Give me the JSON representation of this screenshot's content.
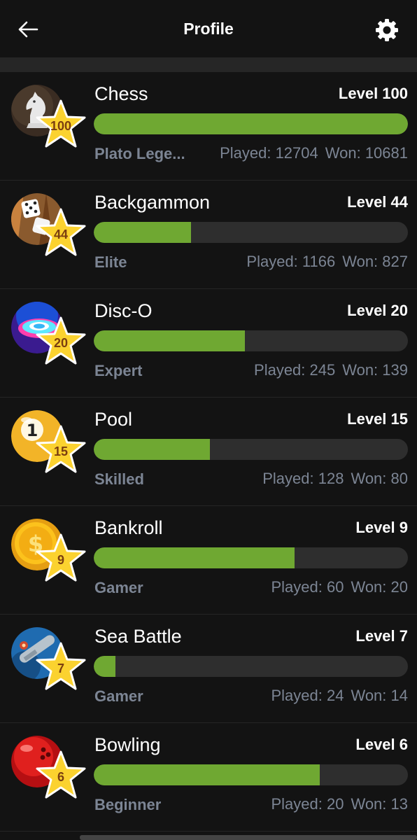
{
  "header": {
    "title": "Profile",
    "back_icon": "arrow-left-icon",
    "settings_icon": "gear-icon"
  },
  "games": [
    {
      "name": "Chess",
      "level": "Level 100",
      "badge": "100",
      "progress": 1.0,
      "rank": "Plato Lege...",
      "played": "Played: 12704",
      "won": "Won: 10681",
      "icon": "chess-knight-icon"
    },
    {
      "name": "Backgammon",
      "level": "Level 44",
      "badge": "44",
      "progress": 0.31,
      "rank": "Elite",
      "played": "Played: 1166",
      "won": "Won: 827",
      "icon": "dice-icon"
    },
    {
      "name": "Disc-O",
      "level": "Level 20",
      "badge": "20",
      "progress": 0.48,
      "rank": "Expert",
      "played": "Played: 245",
      "won": "Won: 139",
      "icon": "disc-icon"
    },
    {
      "name": "Pool",
      "level": "Level 15",
      "badge": "15",
      "progress": 0.37,
      "rank": "Skilled",
      "played": "Played: 128",
      "won": "Won: 80",
      "icon": "pool-ball-icon"
    },
    {
      "name": "Bankroll",
      "level": "Level 9",
      "badge": "9",
      "progress": 0.64,
      "rank": "Gamer",
      "played": "Played: 60",
      "won": "Won: 20",
      "icon": "dollar-coin-icon"
    },
    {
      "name": "Sea Battle",
      "level": "Level 7",
      "badge": "7",
      "progress": 0.07,
      "rank": "Gamer",
      "played": "Played: 24",
      "won": "Won: 14",
      "icon": "battleship-icon"
    },
    {
      "name": "Bowling",
      "level": "Level 6",
      "badge": "6",
      "progress": 0.72,
      "rank": "Beginner",
      "played": "Played: 20",
      "won": "Won: 13",
      "icon": "bowling-ball-icon"
    }
  ],
  "colors": {
    "background": "#131313",
    "bar_fill": "#6fa832",
    "bar_track": "#2e2e2e",
    "secondary_text": "#7c8594",
    "star": "#fbd22f"
  }
}
